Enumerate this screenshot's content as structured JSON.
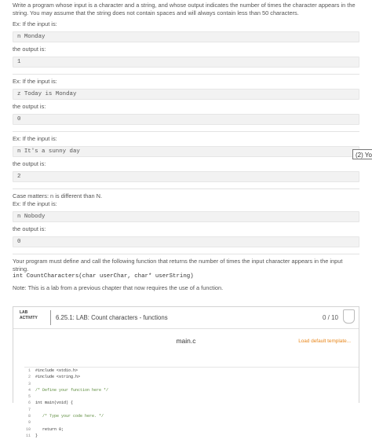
{
  "problem": {
    "intro": "Write a program whose input is a character and a string, and whose output indicates the number of times the character appears in the string. You may assume that the string does not contain spaces and will always contain less than 50 characters.",
    "examples": [
      {
        "input_label": "Ex: If the input is:",
        "input": "n Monday",
        "output_label": "the output is:",
        "output": "1"
      },
      {
        "input_label": "Ex: If the input is:",
        "input": "z Today is Monday",
        "output_label": "the output is:",
        "output": "0"
      },
      {
        "input_label": "Ex: If the input is:",
        "input": "n It's a sunny day",
        "output_label": "the output is:",
        "output": "2"
      }
    ],
    "case_note": "Case matters: n is different than N.",
    "example4": {
      "input_label": "Ex: If the input is:",
      "input": "n Nobody",
      "output_label": "the output is:",
      "output": "0"
    },
    "function_text": "Your program must define and call the following function that returns the number of times the input character appears in the input string.",
    "signature": "int CountCharacters(char userChar, char* userString)",
    "note": "Note: This is a lab from a previous chapter that now requires the use of a function."
  },
  "side_tab": {
    "label": "(2) Yo"
  },
  "lab": {
    "badge_line1": "LAB",
    "badge_line2": "ACTIVITY",
    "title": "6.25.1: LAB: Count characters - functions",
    "score": "0 / 10",
    "file_name": "main.c",
    "load_template": "Load default template...",
    "code": [
      {
        "n": "1",
        "t": "#include <stdio.h>"
      },
      {
        "n": "2",
        "t": "#include <string.h>"
      },
      {
        "n": "3",
        "t": ""
      },
      {
        "n": "4",
        "t": "/* Define your function here */"
      },
      {
        "n": "5",
        "t": ""
      },
      {
        "n": "6",
        "t": "int main(void) {"
      },
      {
        "n": "7",
        "t": ""
      },
      {
        "n": "8",
        "t": "   /* Type your code here. */"
      },
      {
        "n": "9",
        "t": ""
      },
      {
        "n": "10",
        "t": "   return 0;"
      },
      {
        "n": "11",
        "t": "}"
      }
    ]
  }
}
